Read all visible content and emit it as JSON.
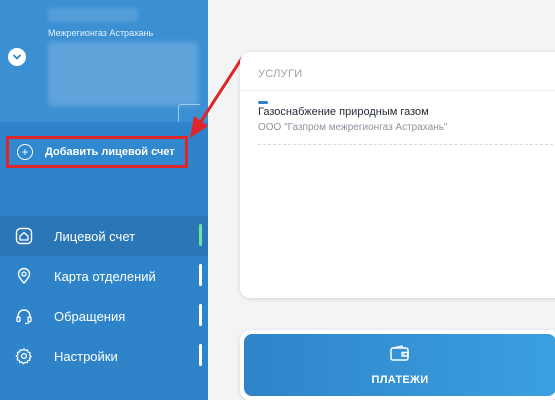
{
  "account": {
    "organization": "Межрегионгаз Астрахань"
  },
  "sidebar": {
    "add_account_label": "Добавить лицевой счет",
    "items": [
      {
        "label": "Лицевой счет",
        "icon": "home-icon",
        "active": true
      },
      {
        "label": "Карта отделений",
        "icon": "map-pin-icon",
        "active": false
      },
      {
        "label": "Обращения",
        "icon": "headset-icon",
        "active": false
      },
      {
        "label": "Настройки",
        "icon": "gear-icon",
        "active": false
      }
    ]
  },
  "services": {
    "title": "УСЛУГИ",
    "items": [
      {
        "name": "Газоснабжение природным газом",
        "provider": "ООО \"Газпром межрегионгаз Астрахань\""
      }
    ]
  },
  "payments": {
    "label": "ПЛАТЕЖИ"
  },
  "colors": {
    "sidebar": "#2f84c9",
    "highlight_border": "#e0262a",
    "active_indicator": "#6fe3a0"
  }
}
